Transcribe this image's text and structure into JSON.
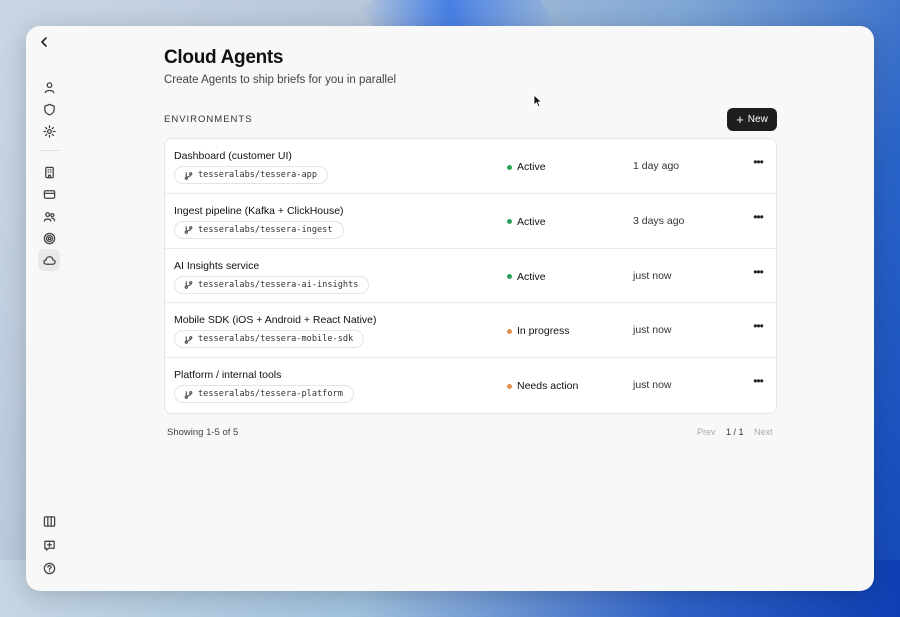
{
  "page": {
    "title": "Cloud Agents",
    "subtitle": "Create Agents to ship briefs for you in parallel",
    "section_label": "ENVIRONMENTS",
    "new_button_label": "New"
  },
  "sidebar": {
    "icons": [
      "back-icon",
      "user-icon",
      "shield-icon",
      "gear-icon",
      "building-icon",
      "credit-card-icon",
      "users-icon",
      "target-icon",
      "cloud-icon",
      "columns-icon",
      "message-plus-icon",
      "help-icon"
    ],
    "active": "cloud-icon"
  },
  "environments": [
    {
      "name": "Dashboard (customer UI)",
      "repo": "tesseralabs/tessera-app",
      "status": "Active",
      "status_color": "#2fa35a",
      "updated": "1 day ago"
    },
    {
      "name": "Ingest pipeline (Kafka + ClickHouse)",
      "repo": "tesseralabs/tessera-ingest",
      "status": "Active",
      "status_color": "#2fa35a",
      "updated": "3 days ago"
    },
    {
      "name": "AI Insights service",
      "repo": "tesseralabs/tessera-ai-insights",
      "status": "Active",
      "status_color": "#2fa35a",
      "updated": "just now"
    },
    {
      "name": "Mobile SDK (iOS + Android + React Native)",
      "repo": "tesseralabs/tessera-mobile-sdk",
      "status": "In progress",
      "status_color": "#e0944a",
      "updated": "just now"
    },
    {
      "name": "Platform / internal tools",
      "repo": "tesseralabs/tessera-platform",
      "status": "Needs action",
      "status_color": "#e0944a",
      "updated": "just now"
    }
  ],
  "footer": {
    "showing": "Showing 1-5 of 5",
    "prev": "Prev",
    "page": "1 / 1",
    "next": "Next"
  }
}
